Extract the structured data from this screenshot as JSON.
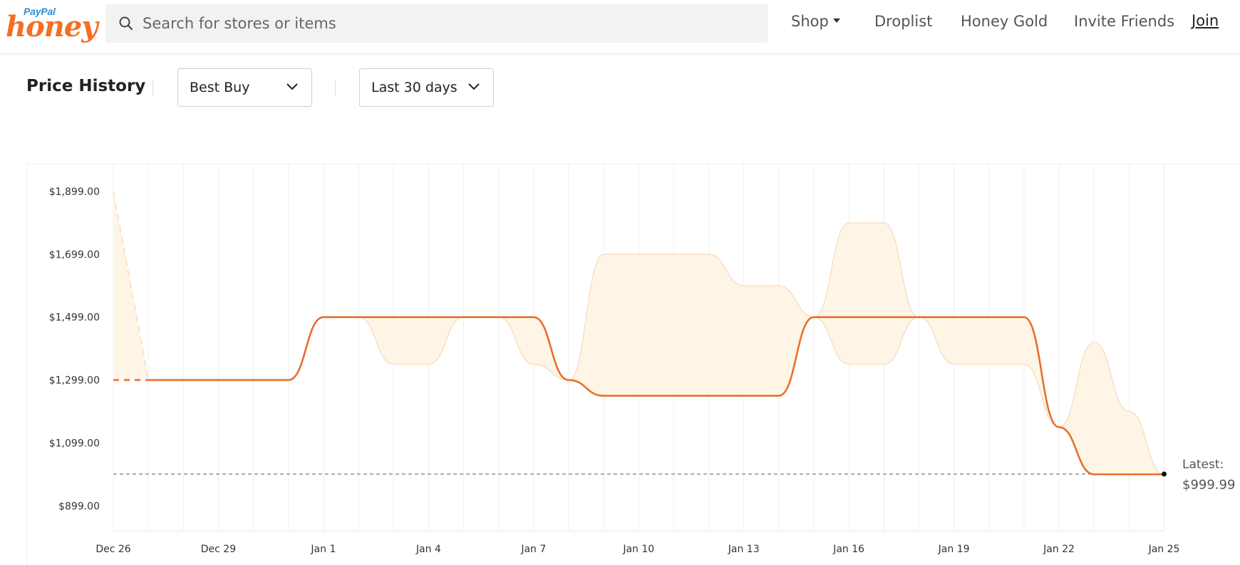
{
  "header": {
    "logo_paypal": "PayPal",
    "logo_honey": "honey",
    "search_placeholder": "Search for stores or items",
    "nav": {
      "shop": "Shop",
      "droplist": "Droplist",
      "honey_gold": "Honey Gold",
      "invite": "Invite Friends",
      "join": "Join"
    }
  },
  "controls": {
    "title": "Price History",
    "store_select": "Best Buy",
    "range_select": "Last 30 days"
  },
  "colors": {
    "brand": "#f36f21",
    "line": "#e8702a",
    "band_fill": "#fff5e6",
    "band_stroke": "#f7d9bd",
    "grid": "#efefef"
  },
  "chart_data": {
    "type": "line",
    "title": "Price History",
    "xlabel": "",
    "ylabel": "",
    "x_tick_labels": [
      "Dec 26",
      "Dec 29",
      "Jan 1",
      "Jan 4",
      "Jan 7",
      "Jan 10",
      "Jan 13",
      "Jan 16",
      "Jan 19",
      "Jan 22",
      "Jan 25"
    ],
    "y_tick_labels": [
      "$1,899.00",
      "$1,699.00",
      "$1,499.00",
      "$1,299.00",
      "$1,099.00",
      "$899.00"
    ],
    "y_ticks": [
      1899,
      1699,
      1499,
      1299,
      1099,
      899
    ],
    "ylim": [
      815,
      1899
    ],
    "x": [
      "Dec 26",
      "Dec 27",
      "Dec 28",
      "Dec 29",
      "Dec 30",
      "Dec 31",
      "Jan 1",
      "Jan 2",
      "Jan 3",
      "Jan 4",
      "Jan 5",
      "Jan 6",
      "Jan 7",
      "Jan 8",
      "Jan 9",
      "Jan 10",
      "Jan 11",
      "Jan 12",
      "Jan 13",
      "Jan 14",
      "Jan 15",
      "Jan 16",
      "Jan 17",
      "Jan 18",
      "Jan 19",
      "Jan 20",
      "Jan 21",
      "Jan 22",
      "Jan 23",
      "Jan 24",
      "Jan 25"
    ],
    "series": [
      {
        "values": [
          1299,
          1299,
          1299,
          1299,
          1299,
          1299,
          1499,
          1499,
          1499,
          1499,
          1499,
          1499,
          1499,
          1299,
          1249,
          1249,
          1249,
          1249,
          1249,
          1249,
          1499,
          1499,
          1499,
          1499,
          1499,
          1499,
          1499,
          1149,
          999,
          999,
          999
        ]
      }
    ],
    "range_band": {
      "high": [
        1899,
        1299,
        1299,
        1299,
        1299,
        1299,
        1499,
        1499,
        1499,
        1499,
        1499,
        1499,
        1499,
        1299,
        1699,
        1699,
        1699,
        1699,
        1599,
        1599,
        1499,
        1799,
        1799,
        1499,
        1499,
        1499,
        1499,
        1149,
        1419,
        1199,
        999
      ],
      "low": [
        1299,
        1299,
        1299,
        1299,
        1299,
        1299,
        1499,
        1499,
        1349,
        1349,
        1499,
        1499,
        1349,
        1299,
        1249,
        1249,
        1249,
        1249,
        1249,
        1249,
        1499,
        1349,
        1349,
        1499,
        1349,
        1349,
        1349,
        1149,
        999,
        999,
        999
      ]
    },
    "latest_price": 999.99,
    "latest_label": "Latest:",
    "latest_value_label": "$999.99",
    "grid": true
  }
}
